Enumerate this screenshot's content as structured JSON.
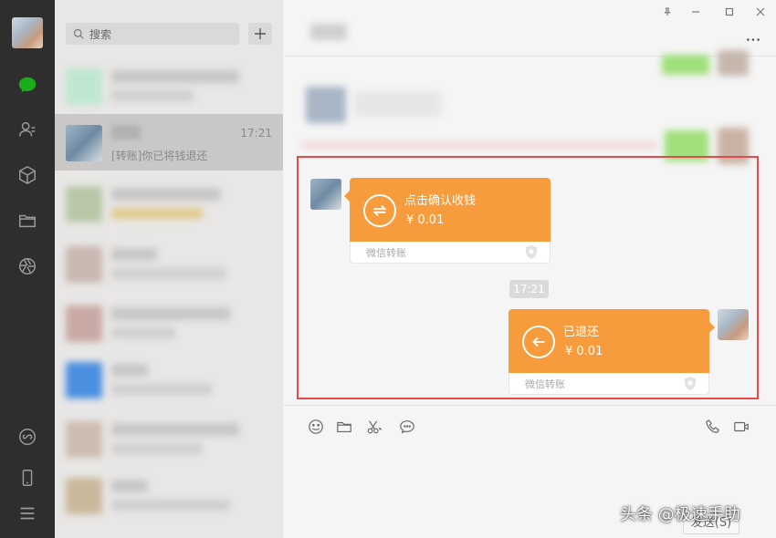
{
  "search": {
    "placeholder": "搜索"
  },
  "conversation_list": {
    "active": {
      "time": "17:21",
      "preview": "[转账]你已将钱退还"
    }
  },
  "chat": {
    "received_transfer": {
      "title": "点击确认收钱",
      "amount": "¥ 0.01",
      "footer": "微信转账"
    },
    "timestamp": "17:21",
    "returned_transfer": {
      "title": "已退还",
      "amount": "¥ 0.01",
      "footer": "微信转账"
    }
  },
  "input": {
    "send_label": "发送(S)"
  },
  "watermark": "头条 @极速手助",
  "colors": {
    "transfer_orange": "#f79c3c",
    "highlight_red": "#e54b4b",
    "nav_green": "#1aad19",
    "nav_bg": "#2e2e2e"
  },
  "icons": {
    "nav": [
      "chat-icon",
      "contacts-icon",
      "favorites-icon",
      "files-icon",
      "moments-icon",
      "miniprogram-icon",
      "phone-icon",
      "menu-icon"
    ],
    "toolbar": [
      "emoji-icon",
      "folder-icon",
      "scissors-icon",
      "chat-bubble-icon",
      "voice-call-icon",
      "video-call-icon"
    ]
  }
}
